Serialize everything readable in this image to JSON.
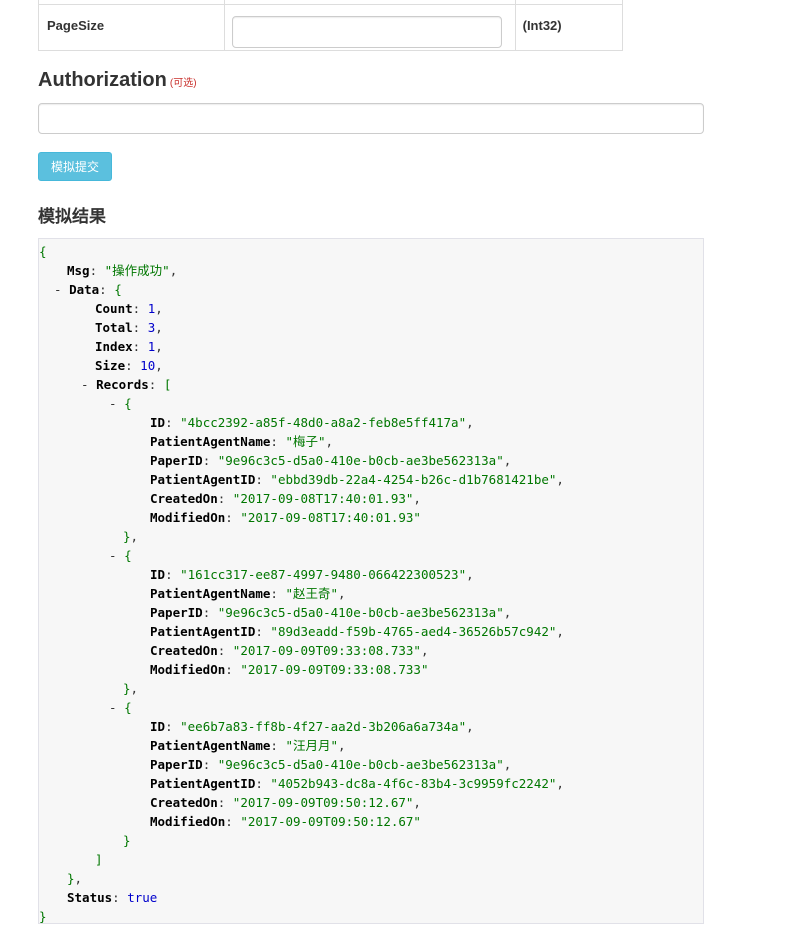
{
  "param": {
    "name": "PageSize",
    "type": "(Int32)",
    "value": ""
  },
  "authorization": {
    "title": "Authorization",
    "optional": "(可选)",
    "value": ""
  },
  "submit_label": "模拟提交",
  "result_title": "模拟结果",
  "result": {
    "msg_key": "Msg",
    "msg_val": "\"操作成功\"",
    "data_key": "Data",
    "count_key": "Count",
    "count_val": "1",
    "total_key": "Total",
    "total_val": "3",
    "index_key": "Index",
    "index_val": "1",
    "size_key": "Size",
    "size_val": "10",
    "records_key": "Records",
    "records": [
      {
        "id": "\"4bcc2392-a85f-48d0-a8a2-feb8e5ff417a\"",
        "name": "\"梅子\"",
        "paper": "\"9e96c3c5-d5a0-410e-b0cb-ae3be562313a\"",
        "agent": "\"ebbd39db-22a4-4254-b26c-d1b7681421be\"",
        "created": "\"2017-09-08T17:40:01.93\"",
        "modified": "\"2017-09-08T17:40:01.93\""
      },
      {
        "id": "\"161cc317-ee87-4997-9480-066422300523\"",
        "name": "\"赵王奇\"",
        "paper": "\"9e96c3c5-d5a0-410e-b0cb-ae3be562313a\"",
        "agent": "\"89d3eadd-f59b-4765-aed4-36526b57c942\"",
        "created": "\"2017-09-09T09:33:08.733\"",
        "modified": "\"2017-09-09T09:33:08.733\""
      },
      {
        "id": "\"ee6b7a83-ff8b-4f27-aa2d-3b206a6a734a\"",
        "name": "\"汪月月\"",
        "paper": "\"9e96c3c5-d5a0-410e-b0cb-ae3be562313a\"",
        "agent": "\"4052b943-dc8a-4f6c-83b4-3c9959fc2242\"",
        "created": "\"2017-09-09T09:50:12.67\"",
        "modified": "\"2017-09-09T09:50:12.67\""
      }
    ],
    "record_keys": {
      "id": "ID",
      "name": "PatientAgentName",
      "paper": "PaperID",
      "agent": "PatientAgentID",
      "created": "CreatedOn",
      "modified": "ModifiedOn"
    },
    "status_key": "Status",
    "status_val": "true"
  }
}
